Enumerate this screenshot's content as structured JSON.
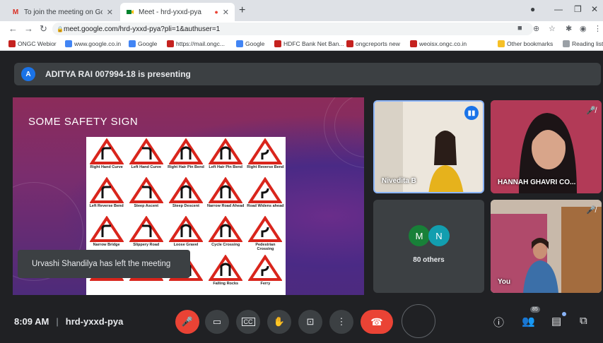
{
  "browser": {
    "tabs": [
      {
        "label": "To join the meeting on Google M",
        "favicon": "M"
      },
      {
        "label": "Meet - hrd-yxxd-pya",
        "favicon": "meet"
      }
    ],
    "url": "meet.google.com/hrd-yxxd-pya?pli=1&authuser=1",
    "bookmarks": [
      {
        "label": "ONGC Webior",
        "color": "#c5221f"
      },
      {
        "label": "www.google.co.in",
        "color": "#4285f4"
      },
      {
        "label": "Google",
        "color": "#4285f4"
      },
      {
        "label": "https://mail.ongc...",
        "color": "#c5221f"
      },
      {
        "label": "Google",
        "color": "#4285f4"
      },
      {
        "label": "HDFC Bank Net Ban...",
        "color": "#c5221f"
      },
      {
        "label": "ongcreports new",
        "color": "#c5221f"
      },
      {
        "label": "weoisx.ongc.co.in",
        "color": "#c5221f"
      }
    ],
    "other_bookmarks": "Other bookmarks",
    "reading_list": "Reading list"
  },
  "meet": {
    "presenting": {
      "avatar": "A",
      "text": "ADITYA RAI 007994-18 is presenting"
    },
    "slide": {
      "title": "SOME SAFETY SIGN",
      "signs": [
        "Right Hand Curve",
        "Left Hand Curve",
        "Right Hair Pin Bend",
        "Left Hair Pin Bend",
        "Right Reverse Bend",
        "Left Reverse Bend",
        "Steep Ascent",
        "Steep Descent",
        "Narrow Road Ahead",
        "Road Widens ahead",
        "Narrow Bridge",
        "Slippery Road",
        "Loose Gravel",
        "Cycle Crossing",
        "Pedestrian Crossing",
        "",
        "",
        "",
        "Falling Rocks",
        "Ferry"
      ]
    },
    "toast": "Urvashi Shandilya has left the meeting",
    "participants": {
      "nivedita": "Nivedita B",
      "hannah": "HANNAH GHAVRI CO...",
      "others_avatars": [
        "M",
        "N"
      ],
      "others_label": "80 others",
      "you": "You"
    },
    "time": "8:09 AM",
    "meeting_code": "hrd-yxxd-pya",
    "participant_count": "85"
  }
}
